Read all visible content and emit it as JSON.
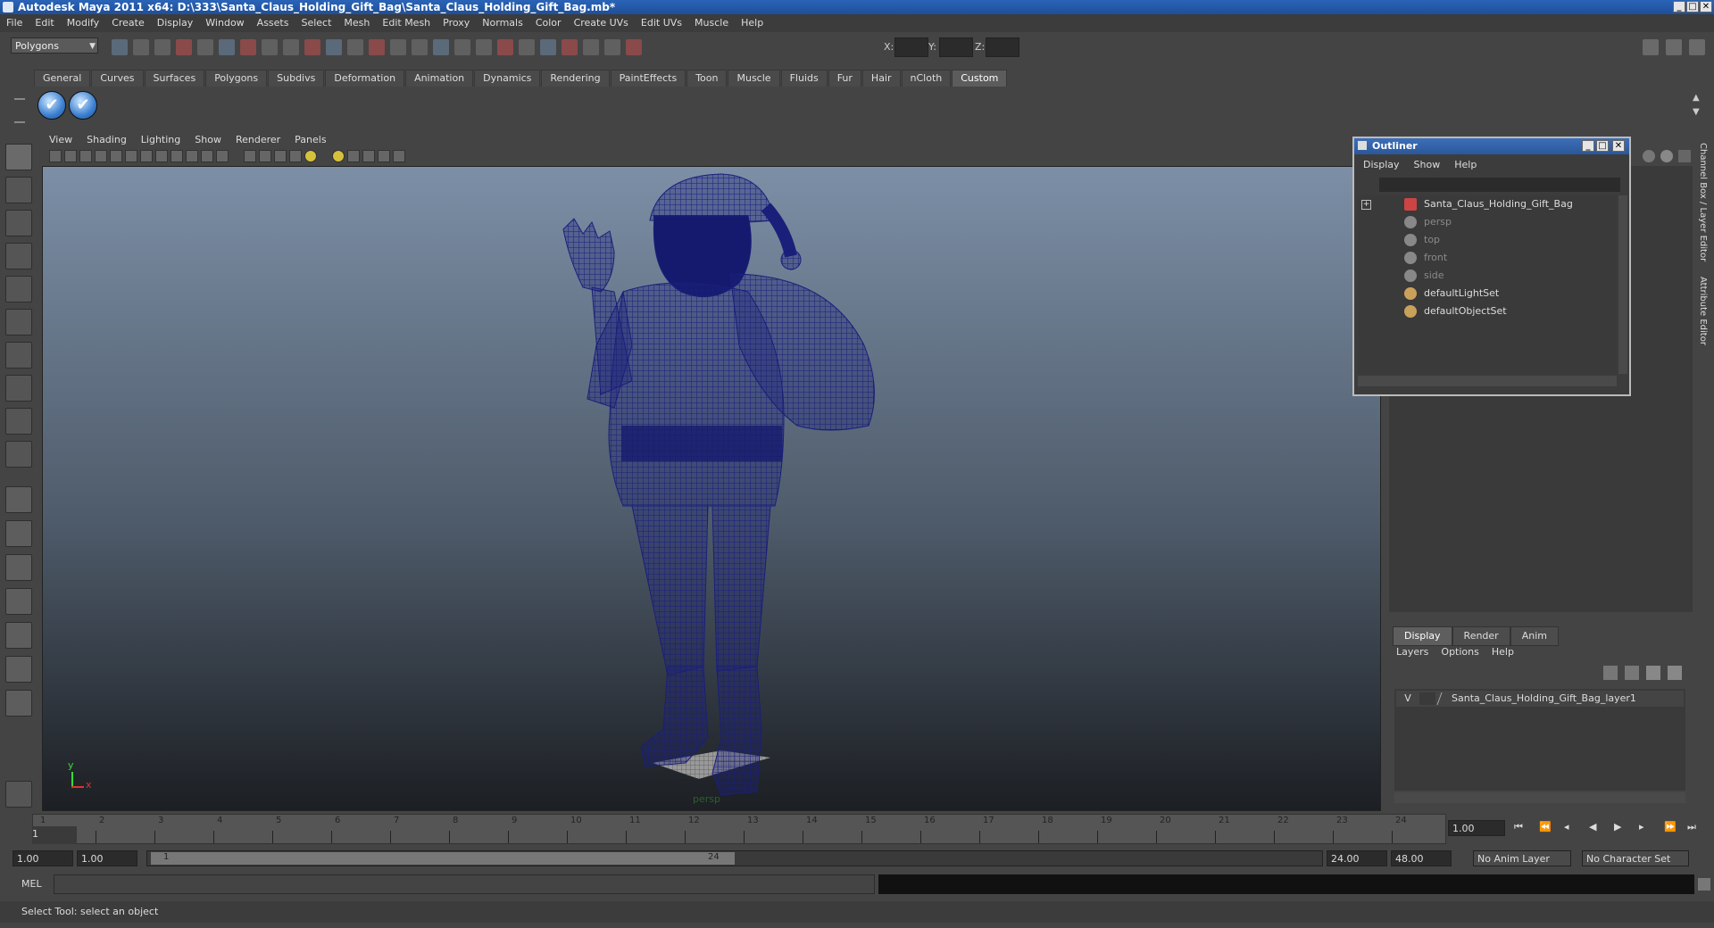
{
  "window": {
    "title": "Autodesk Maya 2011 x64: D:\\333\\Santa_Claus_Holding_Gift_Bag\\Santa_Claus_Holding_Gift_Bag.mb*"
  },
  "menubar": {
    "items": [
      "File",
      "Edit",
      "Modify",
      "Create",
      "Display",
      "Window",
      "Assets",
      "Select",
      "Mesh",
      "Edit Mesh",
      "Proxy",
      "Normals",
      "Color",
      "Create UVs",
      "Edit UVs",
      "Muscle",
      "Help"
    ]
  },
  "statusline": {
    "mode": "Polygons",
    "x_label": "X:",
    "y_label": "Y:",
    "z_label": "Z:"
  },
  "shelf": {
    "tabs": [
      "General",
      "Curves",
      "Surfaces",
      "Polygons",
      "Subdivs",
      "Deformation",
      "Animation",
      "Dynamics",
      "Rendering",
      "PaintEffects",
      "Toon",
      "Muscle",
      "Fluids",
      "Fur",
      "Hair",
      "nCloth",
      "Custom"
    ],
    "active": "Custom"
  },
  "panel": {
    "menus": [
      "View",
      "Shading",
      "Lighting",
      "Show",
      "Renderer",
      "Panels"
    ],
    "camera_label": "persp",
    "axis_y": "y",
    "axis_x": "x"
  },
  "outliner": {
    "title": "Outliner",
    "menus": [
      "Display",
      "Show",
      "Help"
    ],
    "items": [
      {
        "label": "Santa_Claus_Holding_Gift_Bag",
        "dimmed": false,
        "icon": "mesh-icon"
      },
      {
        "label": "persp",
        "dimmed": true,
        "icon": "camera-icon"
      },
      {
        "label": "top",
        "dimmed": true,
        "icon": "camera-icon"
      },
      {
        "label": "front",
        "dimmed": true,
        "icon": "camera-icon"
      },
      {
        "label": "side",
        "dimmed": true,
        "icon": "camera-icon"
      },
      {
        "label": "defaultLightSet",
        "dimmed": false,
        "icon": "set-icon"
      },
      {
        "label": "defaultObjectSet",
        "dimmed": false,
        "icon": "set-icon"
      }
    ]
  },
  "sidetabs": {
    "channel": "Channel Box / Layer Editor",
    "attribute": "Attribute Editor"
  },
  "layers": {
    "tabs": [
      "Display",
      "Render",
      "Anim"
    ],
    "active": "Display",
    "menus": [
      "Layers",
      "Options",
      "Help"
    ],
    "layer_visible": "V",
    "layer_name": "Santa_Claus_Holding_Gift_Bag_layer1"
  },
  "timeline": {
    "ticks": [
      "1",
      "2",
      "3",
      "4",
      "5",
      "6",
      "7",
      "8",
      "9",
      "10",
      "11",
      "12",
      "13",
      "14",
      "15",
      "16",
      "17",
      "18",
      "19",
      "20",
      "21",
      "22",
      "23",
      "24"
    ],
    "current_frame_marker": "1",
    "current_time": "1.00"
  },
  "range": {
    "start": "1.00",
    "playback_start": "1.00",
    "slider_start": "1",
    "slider_end": "24",
    "playback_end": "24.00",
    "end": "48.00",
    "anim_layer": "No Anim Layer",
    "char_set": "No Character Set"
  },
  "command": {
    "label": "MEL"
  },
  "help": {
    "text": "Select Tool: select an object"
  },
  "colors": {
    "wireframe": "#1a1f7a",
    "title_blue": "#2a64b8"
  }
}
